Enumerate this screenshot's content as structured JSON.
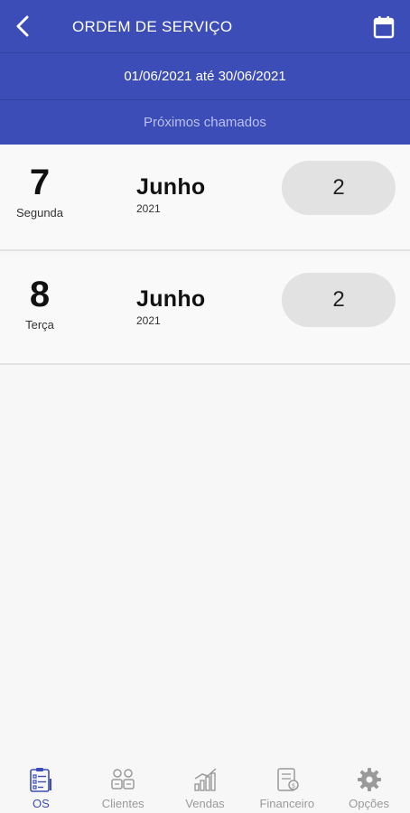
{
  "header": {
    "title": "ORDEM DE SERVIÇO",
    "back_icon": "chevron-left-icon",
    "calendar_icon": "calendar-icon",
    "date_range": "01/06/2021 até 30/06/2021",
    "subtitle": "Próximos chamados"
  },
  "list": [
    {
      "day": "7",
      "weekday": "Segunda",
      "month": "Junho",
      "year": "2021",
      "count": "2"
    },
    {
      "day": "8",
      "weekday": "Terça",
      "month": "Junho",
      "year": "2021",
      "count": "2"
    }
  ],
  "tabs": [
    {
      "label": "OS",
      "icon": "clipboard-icon",
      "active": true
    },
    {
      "label": "Clientes",
      "icon": "clients-icon",
      "active": false
    },
    {
      "label": "Vendas",
      "icon": "sales-chart-icon",
      "active": false
    },
    {
      "label": "Financeiro",
      "icon": "finance-icon",
      "active": false
    },
    {
      "label": "Opções",
      "icon": "gear-icon",
      "active": false
    }
  ],
  "colors": {
    "primary": "#3d4db7",
    "inactive": "#9a9a9a",
    "pill": "#e2e2e2"
  }
}
